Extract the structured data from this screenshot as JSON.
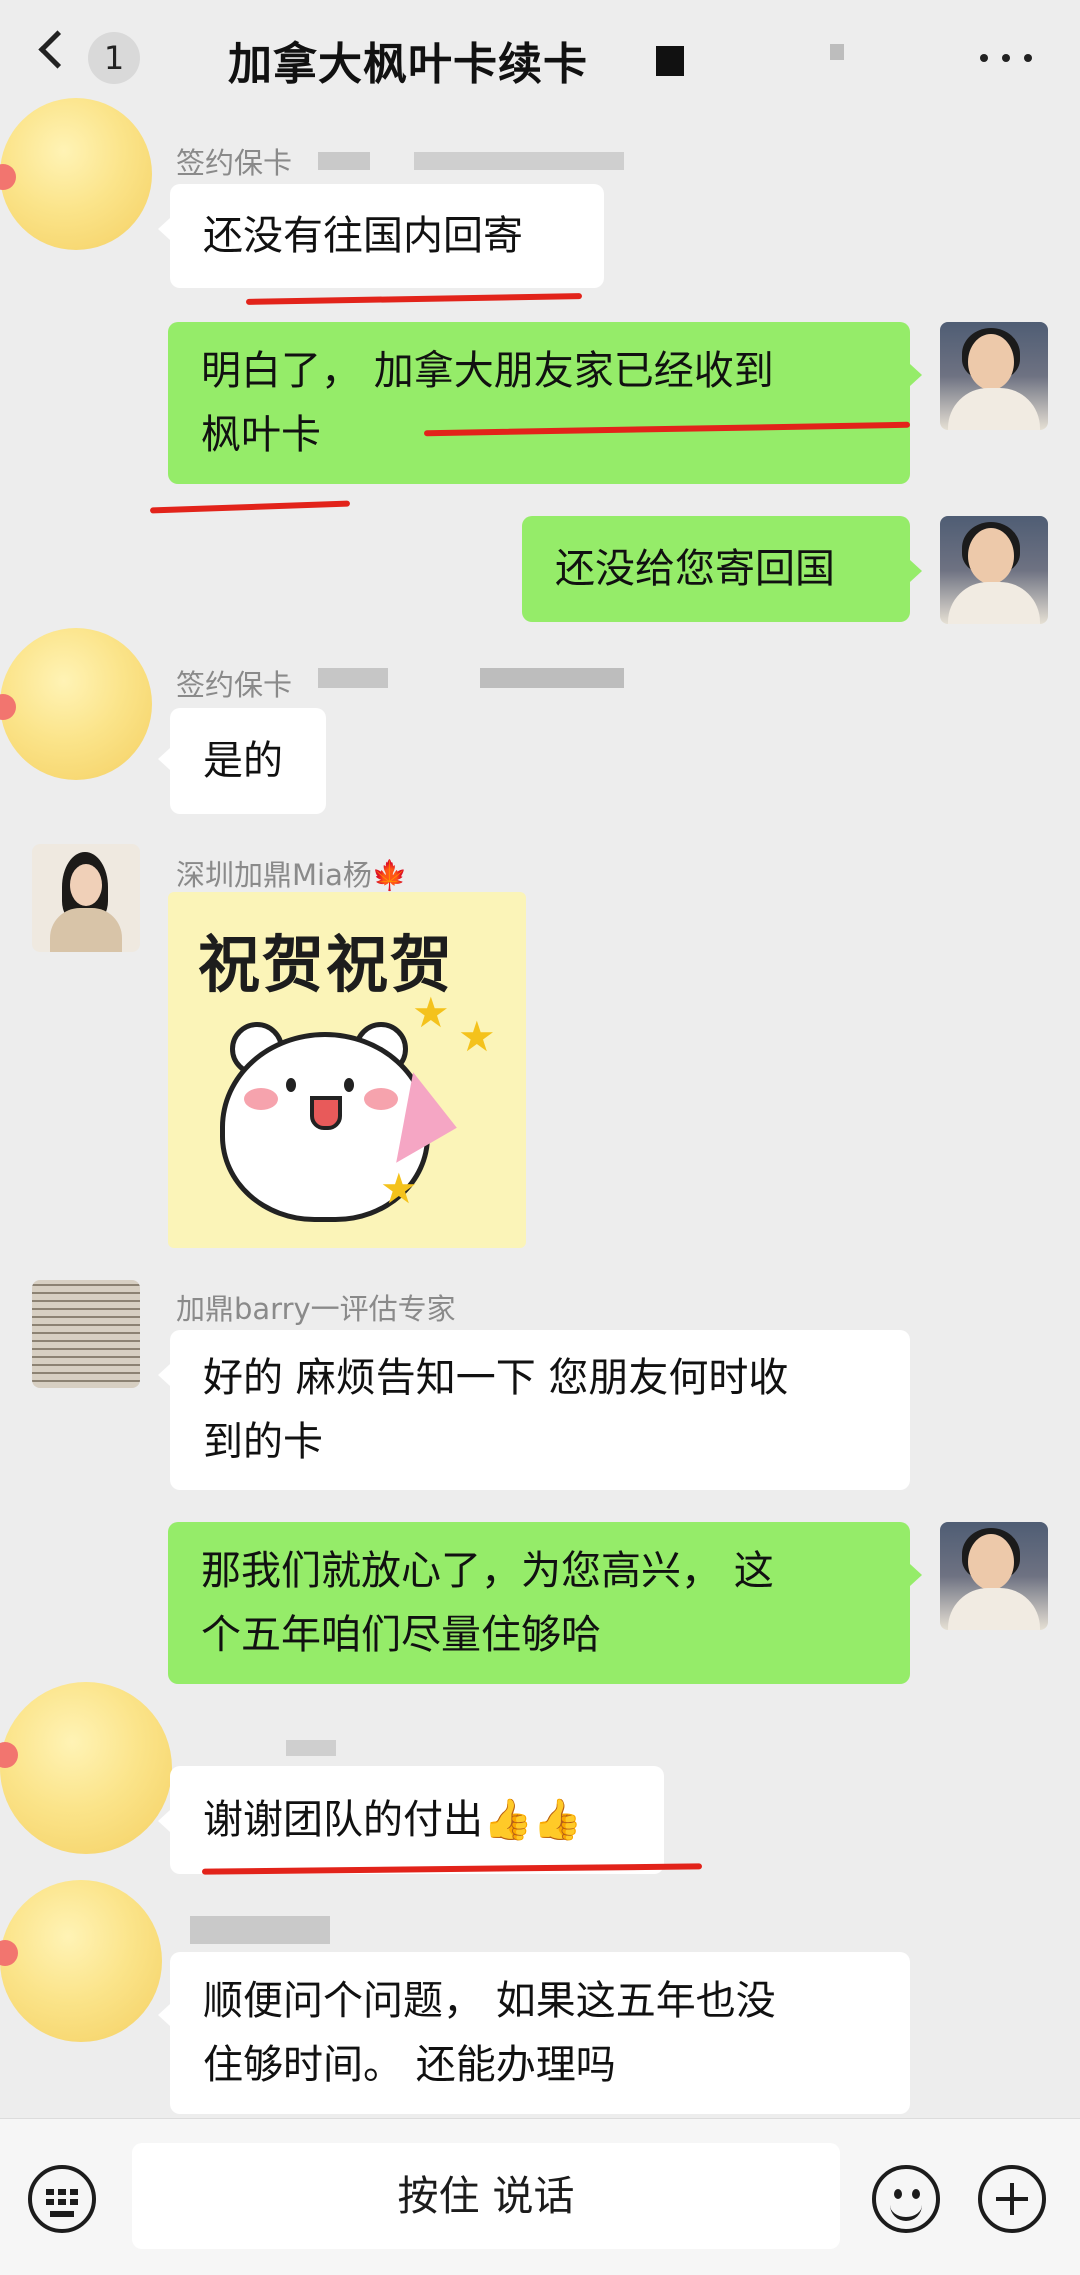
{
  "header": {
    "back_label": "<",
    "unread_count": "1",
    "title": "加拿大枫叶卡续卡",
    "more_label": "···"
  },
  "messages": [
    {
      "id": "m1",
      "side": "left",
      "sender": "签约保卡",
      "avatar": "smiley-emoji-avatar",
      "text": "还没有往国内回寄"
    },
    {
      "id": "m2",
      "side": "right",
      "avatar": "self-photo-avatar",
      "lines": [
        "明白了，  加拿大朋友家已经收到",
        "枫叶卡"
      ]
    },
    {
      "id": "m3",
      "side": "right",
      "avatar": "self-photo-avatar",
      "text": "还没给您寄回国"
    },
    {
      "id": "m4",
      "side": "left",
      "sender": "签约保卡",
      "avatar": "smiley-emoji-avatar",
      "text": "是的"
    },
    {
      "id": "m5",
      "side": "left",
      "sender": "深圳加鼎Mia杨🍁",
      "avatar": "mia-photo-avatar",
      "sticker": {
        "text": "祝贺祝贺",
        "icon": "celebration-bear-sticker"
      }
    },
    {
      "id": "m6",
      "side": "left",
      "sender": "加鼎barry一评估专家",
      "avatar": "calligraphy-avatar",
      "lines": [
        "好的  麻烦告知一下 您朋友何时收",
        "到的卡"
      ]
    },
    {
      "id": "m7",
      "side": "right",
      "avatar": "self-photo-avatar",
      "lines": [
        "那我们就放心了，为您高兴，  这",
        "个五年咱们尽量住够哈"
      ]
    },
    {
      "id": "m8",
      "side": "left",
      "avatar": "smiley-emoji-avatar",
      "text": "谢谢团队的付出👍👍"
    },
    {
      "id": "m9",
      "side": "left",
      "avatar": "smiley-emoji-avatar",
      "lines": [
        "顺便问个问题，  如果这五年也没",
        "住够时间。 还能办理吗"
      ]
    }
  ],
  "input_bar": {
    "hold_to_talk": "按住 说话",
    "icons": [
      "keyboard-icon",
      "emoji-icon",
      "plus-icon"
    ]
  },
  "colors": {
    "background": "#ededed",
    "own_bubble": "#95ec69",
    "other_bubble": "#ffffff",
    "annotation_red": "#e2231a"
  }
}
